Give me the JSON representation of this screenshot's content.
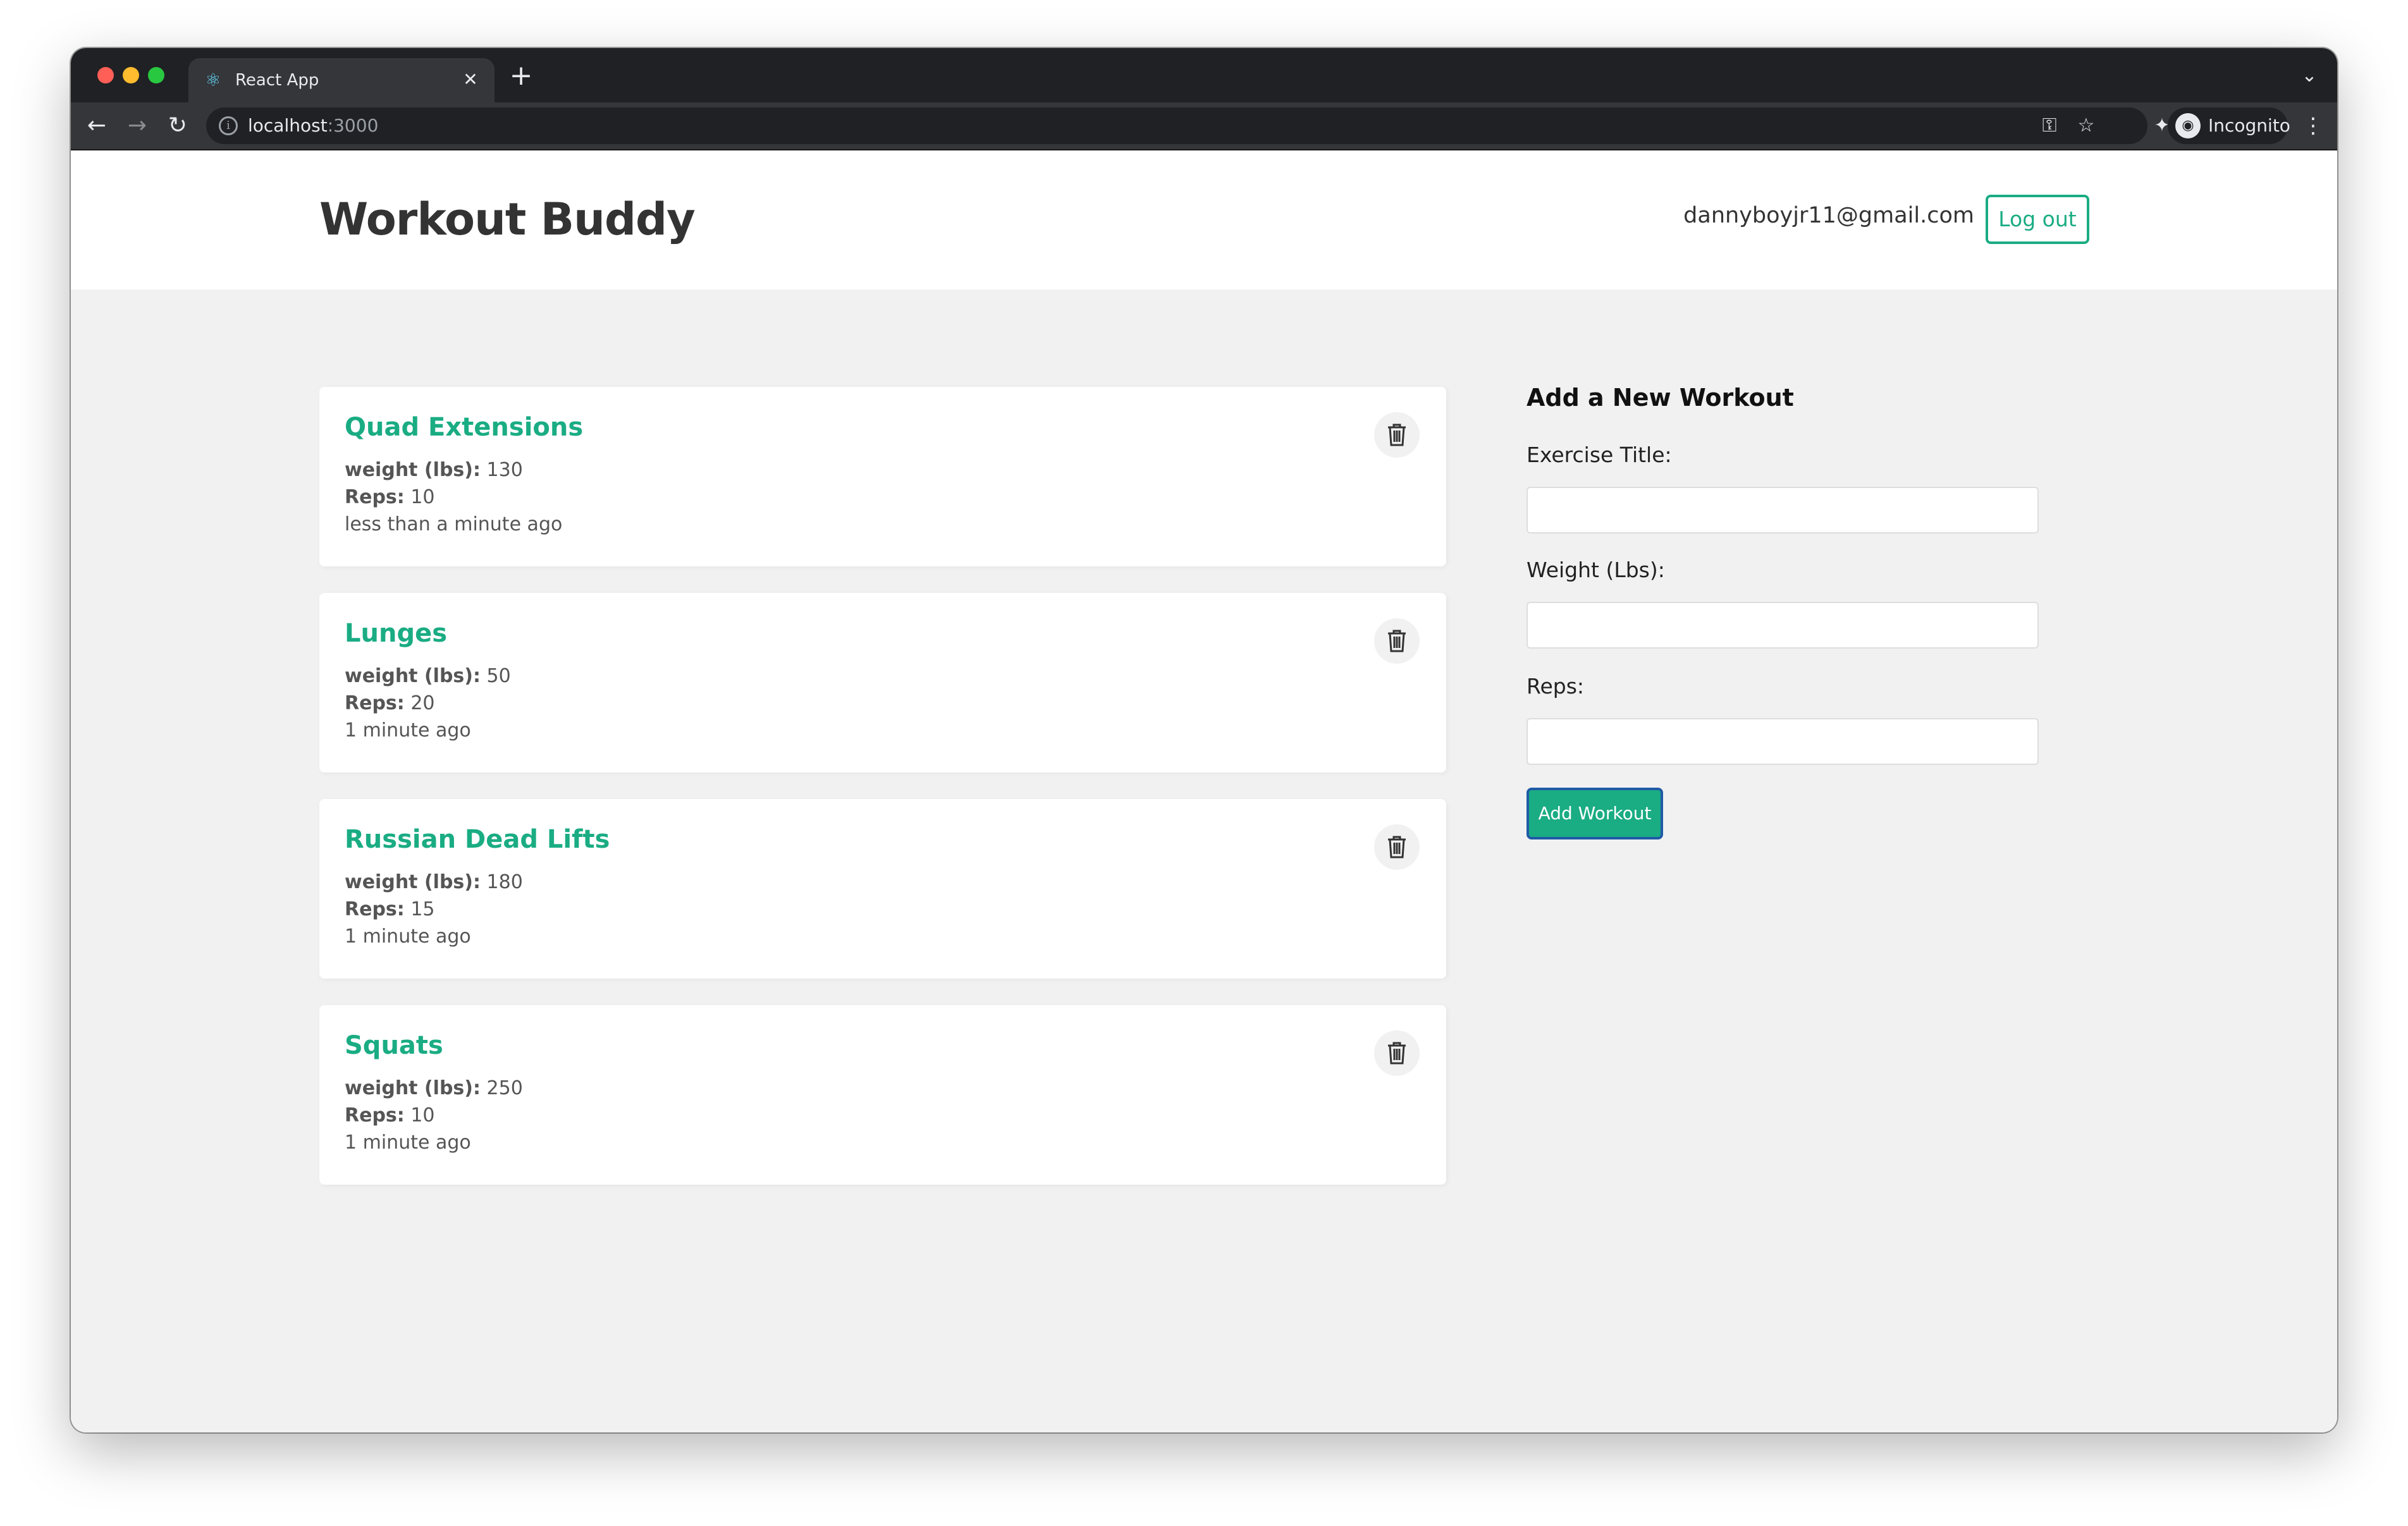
{
  "browser": {
    "tab_title": "React App",
    "url_host": "localhost",
    "url_port": ":3000",
    "profile_label": "Incognito"
  },
  "app": {
    "title": "Workout Buddy",
    "user_email": "dannyboyjr11@gmail.com",
    "logout_label": "Log out"
  },
  "workouts": [
    {
      "title": "Quad Extensions",
      "weight_label": "weight (lbs):",
      "weight": "130",
      "reps_label": "Reps:",
      "reps": "10",
      "time": "less than a minute ago"
    },
    {
      "title": "Lunges",
      "weight_label": "weight (lbs):",
      "weight": "50",
      "reps_label": "Reps:",
      "reps": "20",
      "time": "1 minute ago"
    },
    {
      "title": "Russian Dead Lifts",
      "weight_label": "weight (lbs):",
      "weight": "180",
      "reps_label": "Reps:",
      "reps": "15",
      "time": "1 minute ago"
    },
    {
      "title": "Squats",
      "weight_label": "weight (lbs):",
      "weight": "250",
      "reps_label": "Reps:",
      "reps": "10",
      "time": "1 minute ago"
    }
  ],
  "form": {
    "title": "Add a New Workout",
    "title_label": "Exercise Title:",
    "title_value": "",
    "weight_label": "Weight (Lbs):",
    "weight_value": "",
    "reps_label": "Reps:",
    "reps_value": "",
    "submit_label": "Add Workout"
  },
  "colors": {
    "accent": "#1aac83",
    "background": "#f1f1f1"
  },
  "icons": [
    "react-icon",
    "close-icon",
    "plus-icon",
    "back-icon",
    "forward-icon",
    "reload-icon",
    "info-icon",
    "key-icon",
    "star-icon",
    "extensions-icon",
    "side-panel-icon",
    "incognito-icon",
    "more-icon",
    "trash-icon"
  ]
}
